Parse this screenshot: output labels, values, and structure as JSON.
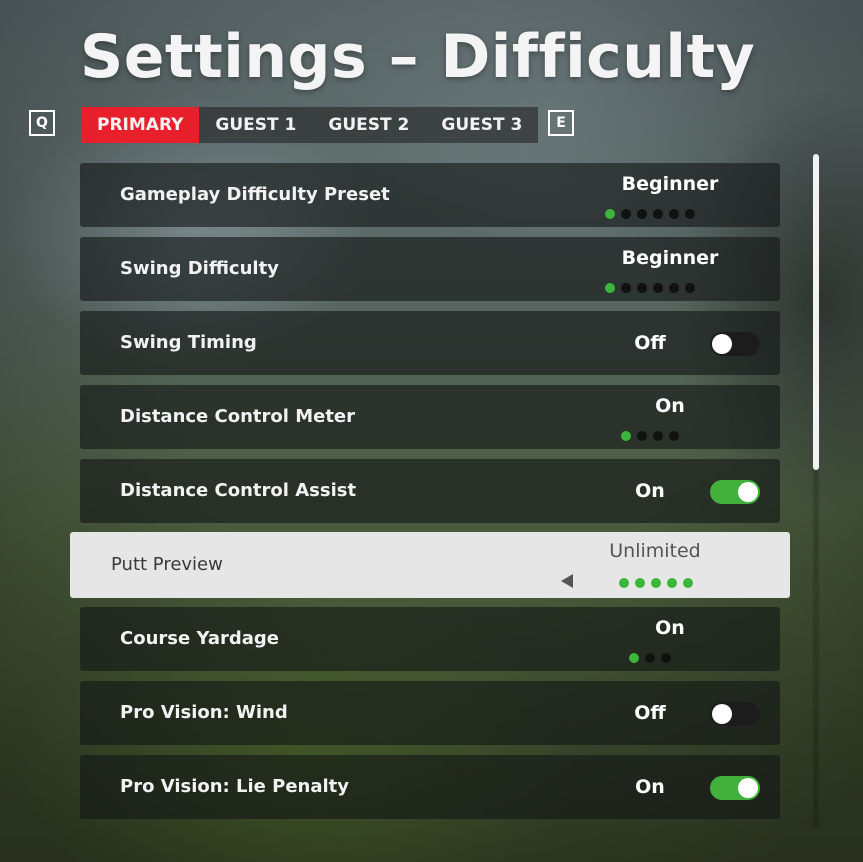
{
  "header": {
    "title": "Settings – Difficulty"
  },
  "nav": {
    "prev_key": "Q",
    "next_key": "E"
  },
  "tabs": [
    {
      "label": "PRIMARY",
      "active": true
    },
    {
      "label": "GUEST 1",
      "active": false
    },
    {
      "label": "GUEST 2",
      "active": false
    },
    {
      "label": "GUEST 3",
      "active": false
    }
  ],
  "settings": [
    {
      "label": "Gameplay Difficulty Preset",
      "value": "Beginner",
      "control": "dots",
      "level": 1,
      "total": 6
    },
    {
      "label": "Swing Difficulty",
      "value": "Beginner",
      "control": "dots",
      "level": 1,
      "total": 6
    },
    {
      "label": "Swing Timing",
      "value": "Off",
      "control": "toggle",
      "state": false
    },
    {
      "label": "Distance Control Meter",
      "value": "On",
      "control": "dots",
      "level": 1,
      "total": 4
    },
    {
      "label": "Distance Control Assist",
      "value": "On",
      "control": "toggle",
      "state": true
    },
    {
      "label": "Putt Preview",
      "value": "Unlimited",
      "control": "dots",
      "level": 5,
      "total": 5,
      "selected": true
    },
    {
      "label": "Course Yardage",
      "value": "On",
      "control": "dots",
      "level": 1,
      "total": 3
    },
    {
      "label": "Pro Vision: Wind",
      "value": "Off",
      "control": "toggle",
      "state": false
    },
    {
      "label": "Pro Vision: Lie Penalty",
      "value": "On",
      "control": "toggle",
      "state": true
    }
  ],
  "colors": {
    "accent": "#e8202b",
    "on_green": "#3bb63b",
    "selected_row": "#e6e6e6"
  },
  "scroll": {
    "position_fraction": 0.0,
    "visible_fraction": 0.47
  }
}
